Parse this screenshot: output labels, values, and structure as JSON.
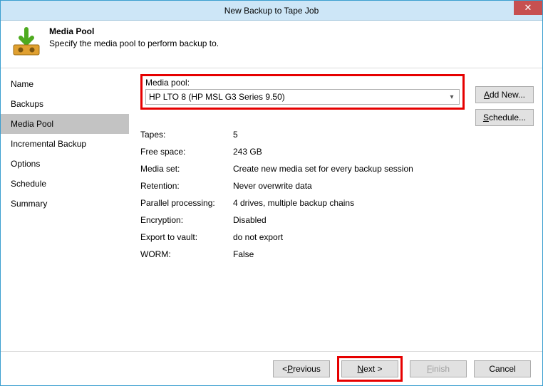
{
  "window": {
    "title": "New Backup to Tape Job"
  },
  "header": {
    "title": "Media Pool",
    "subtitle": "Specify the media pool to perform backup to."
  },
  "sidebar": {
    "items": [
      {
        "label": "Name"
      },
      {
        "label": "Backups"
      },
      {
        "label": "Media Pool"
      },
      {
        "label": "Incremental Backup"
      },
      {
        "label": "Options"
      },
      {
        "label": "Schedule"
      },
      {
        "label": "Summary"
      }
    ]
  },
  "content": {
    "media_pool_label": "Media pool:",
    "media_pool_value": "HP LTO 8 (HP MSL G3 Series 9.50)",
    "buttons": {
      "add_new": "Add New...",
      "schedule": "Schedule..."
    },
    "info": {
      "tapes_label": "Tapes:",
      "tapes_value": "5",
      "free_space_label": "Free space:",
      "free_space_value": "243 GB",
      "media_set_label": "Media set:",
      "media_set_value": "Create new media set for every backup session",
      "retention_label": "Retention:",
      "retention_value": "Never overwrite data",
      "parallel_label": "Parallel processing:",
      "parallel_value": "4 drives, multiple backup chains",
      "encryption_label": "Encryption:",
      "encryption_value": "Disabled",
      "export_label": "Export to vault:",
      "export_value": "do not export",
      "worm_label": "WORM:",
      "worm_value": "False"
    }
  },
  "footer": {
    "previous": "< Previous",
    "next": "Next >",
    "finish": "Finish",
    "cancel": "Cancel"
  }
}
